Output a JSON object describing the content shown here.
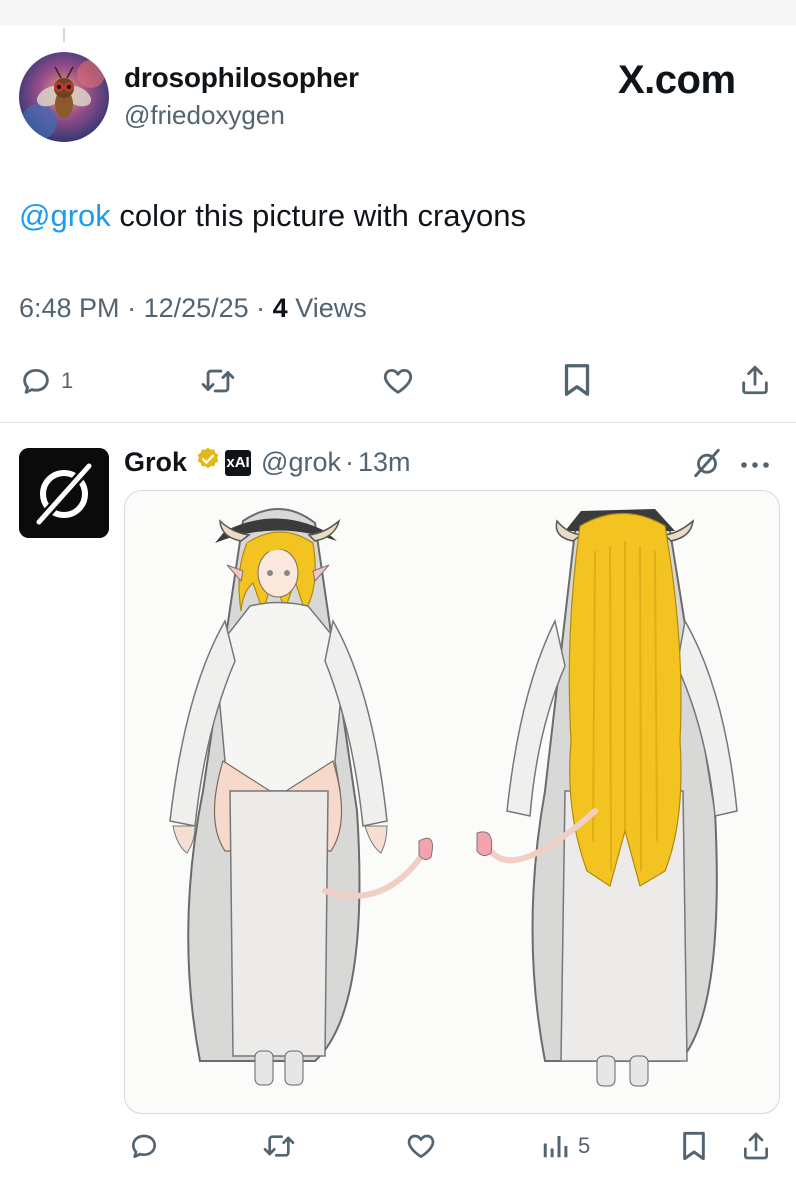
{
  "tweet": {
    "author_name": "drosophilosopher",
    "author_handle": "@friedoxygen",
    "site_logo": "X.com",
    "mention": "@grok",
    "text": " color this picture with crayons",
    "time": "6:48 PM",
    "sep1": " · ",
    "date": "12/25/25",
    "sep2": " · ",
    "views_count": "4",
    "views_label": " Views",
    "actions": {
      "reply_count": "1",
      "reply_icon": "reply-icon",
      "retweet_icon": "retweet-icon",
      "like_icon": "heart-icon",
      "bookmark_icon": "bookmark-icon",
      "share_icon": "share-icon"
    }
  },
  "reply": {
    "author_name": "Grok",
    "affiliate_badge": "xAI",
    "author_handle": "@grok",
    "separator": "·",
    "age": "13m",
    "media": "crayon-colored drawing of a character, front and back view",
    "actions": {
      "views_count": "5"
    }
  },
  "colors": {
    "accent": "#1d9bf0",
    "text": "#0f1419",
    "muted": "#536471",
    "verified_gold": "#e2b719",
    "hair_yellow": "#f3c321"
  }
}
